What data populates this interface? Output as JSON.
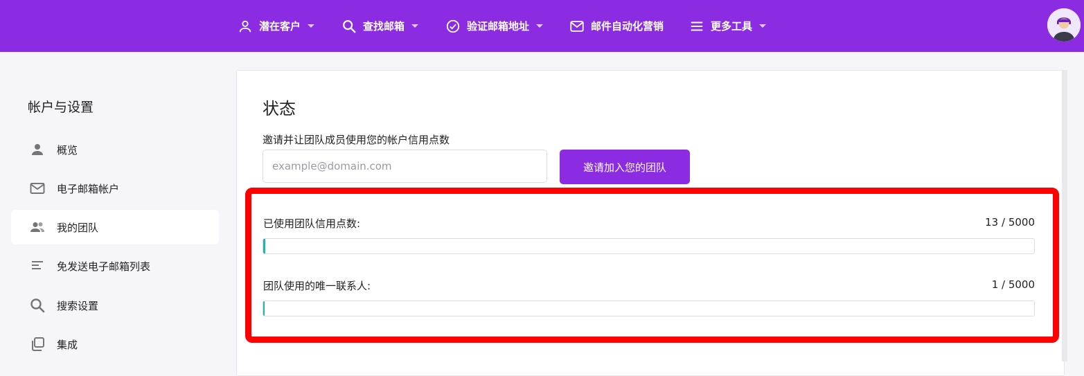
{
  "nav": {
    "items": [
      {
        "label": "潜在客户",
        "icon": "person-icon",
        "has_caret": true
      },
      {
        "label": "查找邮箱",
        "icon": "search-icon",
        "has_caret": true
      },
      {
        "label": "验证邮箱地址",
        "icon": "check-circle-icon",
        "has_caret": true
      },
      {
        "label": "邮件自动化营销",
        "icon": "mail-icon",
        "has_caret": false
      },
      {
        "label": "更多工具",
        "icon": "menu-icon",
        "has_caret": true
      }
    ],
    "accent": "#8b2be2"
  },
  "sidebar": {
    "title": "帐户与设置",
    "items": [
      {
        "label": "概览",
        "icon": "person-icon",
        "active": false
      },
      {
        "label": "电子邮箱帐户",
        "icon": "mail-icon",
        "active": false
      },
      {
        "label": "我的团队",
        "icon": "group-icon",
        "active": true
      },
      {
        "label": "免发送电子邮箱列表",
        "icon": "list-icon",
        "active": false
      },
      {
        "label": "搜索设置",
        "icon": "search-icon",
        "active": false
      },
      {
        "label": "集成",
        "icon": "copy-icon",
        "active": false
      }
    ]
  },
  "main": {
    "title": "状态",
    "invite": {
      "label": "邀请并让团队成员使用您的帐户信用点数",
      "placeholder": "example@domain.com",
      "value": "",
      "button_label": "邀请加入您的团队"
    },
    "stats": [
      {
        "label": "已使用团队信用点数:",
        "value_text": "13 / 5000",
        "used": 13,
        "total": 5000
      },
      {
        "label": "团队使用的唯一联系人:",
        "value_text": "1 / 5000",
        "used": 1,
        "total": 5000
      }
    ],
    "progress_color": "#1ab8b0",
    "highlight_color": "#ff0000"
  }
}
